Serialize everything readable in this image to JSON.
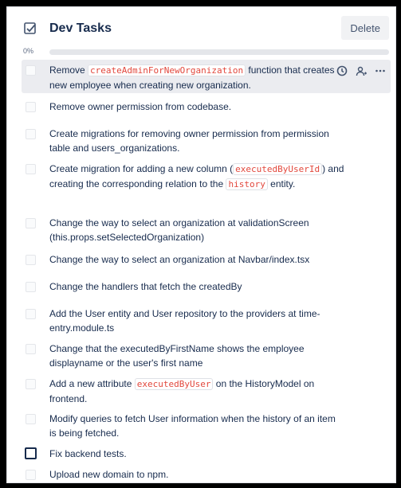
{
  "checklist": {
    "title": "Dev Tasks",
    "delete_label": "Delete",
    "progress_label": "0%",
    "progress_fraction": 0,
    "header_icon": "checkbox-checked-icon",
    "row_action_icons": [
      "clock-icon",
      "assign-member-icon",
      "more-horizontal-icon"
    ],
    "items": [
      {
        "segments": [
          {
            "t": "Remove "
          },
          {
            "c": "createAdminForNewOrganization"
          },
          {
            "t": " function that creates new employee when creating new organization."
          }
        ],
        "checked": false,
        "highlight": true
      },
      {
        "segments": [
          {
            "t": "Remove owner permission from codebase."
          }
        ],
        "checked": false
      },
      {
        "segments": [
          {
            "t": "Create migrations for removing owner permission from permission table and users_organizations."
          }
        ],
        "checked": false
      },
      {
        "segments": [
          {
            "t": "Create migration for adding a new column ("
          },
          {
            "c": "executedByUserId"
          },
          {
            "t": ") and creating the corresponding relation to the "
          },
          {
            "c": "history"
          },
          {
            "t": " entity."
          }
        ],
        "checked": false
      },
      {
        "segments": [
          {
            "t": "Change the way to select an organization at validationScreen (this.props.setSelectedOrganization)"
          }
        ],
        "checked": false
      },
      {
        "segments": [
          {
            "t": "Change the way to select an organization at Navbar/index.tsx"
          }
        ],
        "checked": false
      },
      {
        "segments": [
          {
            "t": "Change the handlers that fetch the createdBy"
          }
        ],
        "checked": false
      },
      {
        "segments": [
          {
            "t": "Add the User entity and User repository to the providers at time-entry.module.ts"
          }
        ],
        "checked": false
      },
      {
        "segments": [
          {
            "t": "Change that the executedByFirstName shows the employee displayname or the user's first name"
          }
        ],
        "checked": false
      },
      {
        "segments": [
          {
            "t": "Add a new attribute "
          },
          {
            "c": "executedByUser"
          },
          {
            "t": " on the HistoryModel on frontend."
          }
        ],
        "checked": false
      },
      {
        "segments": [
          {
            "t": "Modify queries to fetch User information when the history of an item is being fetched."
          }
        ],
        "checked": false
      },
      {
        "segments": [
          {
            "t": "Fix backend tests."
          }
        ],
        "checked": false,
        "dark_box": true
      },
      {
        "segments": [
          {
            "t": "Upload new domain to npm."
          }
        ],
        "checked": false
      }
    ]
  }
}
